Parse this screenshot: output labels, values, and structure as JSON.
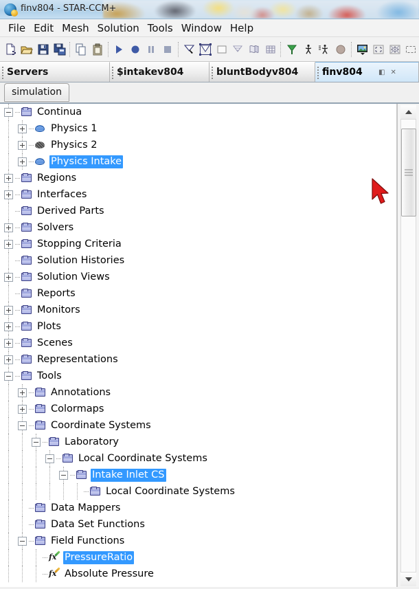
{
  "window": {
    "title": "finv804 - STAR-CCM+",
    "app_icon": "star-ccm-icon"
  },
  "menubar": {
    "items": [
      {
        "label": "File"
      },
      {
        "label": "Edit"
      },
      {
        "label": "Mesh"
      },
      {
        "label": "Solution"
      },
      {
        "label": "Tools"
      },
      {
        "label": "Window"
      },
      {
        "label": "Help"
      }
    ]
  },
  "toolbar": {
    "groups": [
      [
        "new-simulation-icon",
        "open-simulation-icon",
        "save-icon",
        "save-as-icon"
      ],
      [
        "copy-icon",
        "paste-icon"
      ],
      [
        "run-icon",
        "step-icon",
        "pause-icon",
        "stop-icon"
      ],
      [
        "clear-solution-icon",
        "initialize-solution-icon"
      ],
      [
        "new-scene-icon",
        "scalar-scene-icon",
        "vector-scene-icon",
        "mesh-scene-icon"
      ],
      [
        "vector-display-icon",
        "animation-icon",
        "record-icon",
        "sphere-icon"
      ],
      [
        "save-image-icon",
        "fit-view-icon",
        "reset-view-icon",
        "select-region-icon"
      ]
    ]
  },
  "tabs": {
    "items": [
      {
        "label": "Servers",
        "active": false
      },
      {
        "label": "$intakev804",
        "active": false
      },
      {
        "label": "bluntBodyv804",
        "active": false
      },
      {
        "label": "finv804",
        "active": true
      }
    ],
    "active_tab_buttons": {
      "minimize": "◧",
      "close": "✕"
    }
  },
  "subtabs": {
    "items": [
      {
        "label": "simulation",
        "active": true
      }
    ]
  },
  "tree": {
    "nodes": [
      {
        "label": "Continua",
        "depth": 0,
        "toggle": "minus",
        "icon": "folder-icon",
        "selected": false
      },
      {
        "label": "Physics 1",
        "depth": 1,
        "toggle": "plus",
        "icon": "physics-blue-icon",
        "selected": false
      },
      {
        "label": "Physics 2",
        "depth": 1,
        "toggle": "plus",
        "icon": "physics-grey-icon",
        "selected": false
      },
      {
        "label": "Physics Intake",
        "depth": 1,
        "toggle": "plus",
        "icon": "physics-blue-icon",
        "selected": true
      },
      {
        "label": "Regions",
        "depth": 0,
        "toggle": "plus",
        "icon": "folder-icon",
        "selected": false
      },
      {
        "label": "Interfaces",
        "depth": 0,
        "toggle": "plus",
        "icon": "folder-icon",
        "selected": false
      },
      {
        "label": "Derived Parts",
        "depth": 0,
        "toggle": "none",
        "icon": "folder-icon",
        "selected": false
      },
      {
        "label": "Solvers",
        "depth": 0,
        "toggle": "plus",
        "icon": "folder-icon",
        "selected": false
      },
      {
        "label": "Stopping Criteria",
        "depth": 0,
        "toggle": "plus",
        "icon": "folder-icon",
        "selected": false
      },
      {
        "label": "Solution Histories",
        "depth": 0,
        "toggle": "none",
        "icon": "folder-icon",
        "selected": false
      },
      {
        "label": "Solution Views",
        "depth": 0,
        "toggle": "plus",
        "icon": "folder-icon",
        "selected": false
      },
      {
        "label": "Reports",
        "depth": 0,
        "toggle": "none",
        "icon": "folder-icon",
        "selected": false
      },
      {
        "label": "Monitors",
        "depth": 0,
        "toggle": "plus",
        "icon": "folder-icon",
        "selected": false
      },
      {
        "label": "Plots",
        "depth": 0,
        "toggle": "plus",
        "icon": "folder-icon",
        "selected": false
      },
      {
        "label": "Scenes",
        "depth": 0,
        "toggle": "plus",
        "icon": "folder-icon",
        "selected": false
      },
      {
        "label": "Representations",
        "depth": 0,
        "toggle": "plus",
        "icon": "folder-icon",
        "selected": false
      },
      {
        "label": "Tools",
        "depth": 0,
        "toggle": "minus",
        "icon": "folder-icon",
        "selected": false
      },
      {
        "label": "Annotations",
        "depth": 1,
        "toggle": "plus",
        "icon": "folder-icon",
        "selected": false
      },
      {
        "label": "Colormaps",
        "depth": 1,
        "toggle": "plus",
        "icon": "folder-icon",
        "selected": false
      },
      {
        "label": "Coordinate Systems",
        "depth": 1,
        "toggle": "minus",
        "icon": "folder-icon",
        "selected": false
      },
      {
        "label": "Laboratory",
        "depth": 2,
        "toggle": "minus",
        "icon": "folder-icon",
        "selected": false
      },
      {
        "label": "Local Coordinate Systems",
        "depth": 3,
        "toggle": "minus",
        "icon": "folder-icon",
        "selected": false
      },
      {
        "label": "Intake Inlet CS",
        "depth": 4,
        "toggle": "minus",
        "icon": "folder-icon",
        "selected": true
      },
      {
        "label": "Local Coordinate Systems",
        "depth": 5,
        "toggle": "none",
        "icon": "folder-icon",
        "selected": false
      },
      {
        "label": "Data Mappers",
        "depth": 1,
        "toggle": "none",
        "icon": "folder-icon",
        "selected": false
      },
      {
        "label": "Data Set Functions",
        "depth": 1,
        "toggle": "none",
        "icon": "folder-icon",
        "selected": false
      },
      {
        "label": "Field Functions",
        "depth": 1,
        "toggle": "minus",
        "icon": "folder-icon",
        "selected": false
      },
      {
        "label": "PressureRatio",
        "depth": 2,
        "toggle": "none",
        "icon": "field-function-green-icon",
        "selected": true
      },
      {
        "label": "Absolute Pressure",
        "depth": 2,
        "toggle": "none",
        "icon": "field-function-orange-icon",
        "selected": false
      }
    ]
  },
  "scrollbar": {
    "up_arrow": "scroll-up-arrow",
    "down_arrow": "scroll-down-arrow",
    "thumb": "scroll-thumb"
  },
  "colors": {
    "selection_blue": "#3399ff",
    "folder_icon": "#9aa3dd",
    "physics_blue": "#3f7fd8",
    "cursor_red": "#e01b1b"
  }
}
